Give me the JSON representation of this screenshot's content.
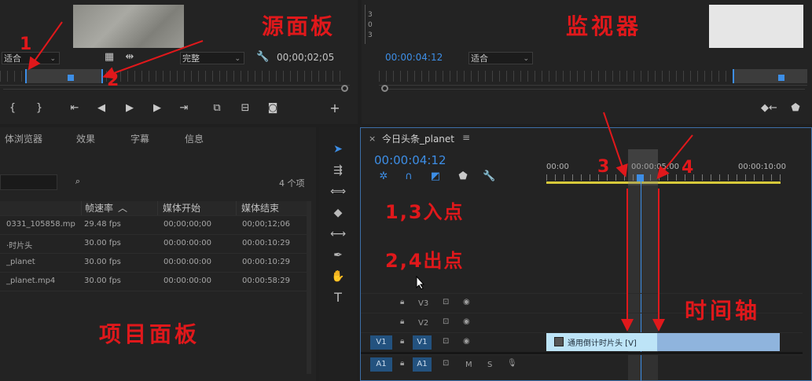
{
  "source_panel": {
    "fit_value": "适合",
    "quality_value": "完整",
    "timecode": "00;00;02;05",
    "annotation_title": "源面板",
    "marker_1": "1",
    "marker_2": "2"
  },
  "monitor_panel": {
    "timecode": "00:00:04:12",
    "fit_value": "适合",
    "annotation_title": "监视器",
    "ruler_labels": [
      "3",
      "0",
      "3"
    ]
  },
  "project_panel": {
    "tabs": [
      "体浏览器",
      "效果",
      "字幕",
      "信息"
    ],
    "item_count": "4 个项",
    "columns": [
      "帧速率",
      "媒体开始",
      "媒体结束"
    ],
    "rows": [
      {
        "name": "0331_105858.mp",
        "fps": "29.48 fps",
        "start": "00;00;00;00",
        "end": "00;00;12;06"
      },
      {
        "name": "·时片头",
        "fps": "30.00 fps",
        "start": "00:00:00:00",
        "end": "00:00:10:29"
      },
      {
        "name": "_planet",
        "fps": "30.00 fps",
        "start": "00:00:00:00",
        "end": "00:00:10:29"
      },
      {
        "name": "_planet.mp4",
        "fps": "30.00 fps",
        "start": "00:00:00:00",
        "end": "00:00:58:29"
      }
    ],
    "annotation_title": "项目面板"
  },
  "timeline_panel": {
    "close_glyph": "×",
    "sequence_name": "今日头条_planet",
    "menu_glyph": "≡",
    "timecode": "00:00:04:12",
    "ruler": [
      "00:00",
      "00:00:05:00",
      "00:00:10:00"
    ],
    "tracks": [
      {
        "target": "",
        "name": "V3",
        "kind": "video"
      },
      {
        "target": "",
        "name": "V2",
        "kind": "video"
      },
      {
        "target": "V1",
        "name": "V1",
        "kind": "video"
      },
      {
        "target": "A1",
        "name": "A1",
        "kind": "audio"
      }
    ],
    "audio_m": "M",
    "audio_s": "S",
    "clip_label": "通用倒计时片头 [V]",
    "annotation_in": "1,3入点",
    "annotation_out": "2,4出点",
    "annotation_title": "时间轴",
    "marker_3": "3",
    "marker_4": "4"
  },
  "colors": {
    "accent_blue": "#3d8ee6",
    "annotation_red": "#e0181b",
    "clip_blue": "#8fb4dd",
    "ruler_yellow": "#d7c93a"
  }
}
